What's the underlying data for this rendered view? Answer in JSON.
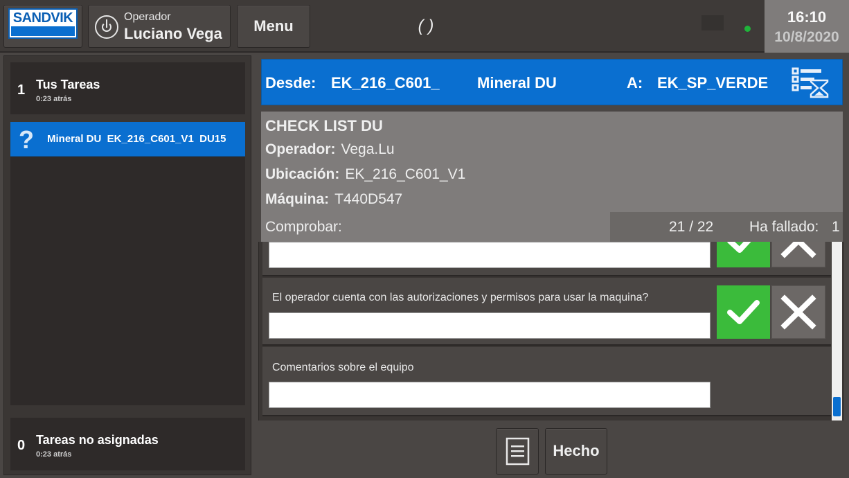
{
  "topbar": {
    "brand": "SANDVIK",
    "operator_label": "Operador",
    "operator_name": "Luciano Vega",
    "menu_label": "Menu",
    "center_text": "( )",
    "time": "16:10",
    "date": "10/8/2020",
    "status_color": "#1fb33a"
  },
  "sidebar": {
    "my_tasks": {
      "count": "1",
      "title": "Tus Tareas",
      "ago": "0:23 atrás"
    },
    "tasks": [
      {
        "icon": "question-icon",
        "label": "Mineral DU  EK_216_C601_V1  DU15"
      }
    ],
    "unassigned": {
      "count": "0",
      "title": "Tareas no asignadas",
      "ago": "0:23 atrás"
    }
  },
  "route": {
    "from_label": "Desde:",
    "from_value": "EK_216_C601_",
    "material": "Mineral DU",
    "to_label": "A:",
    "to_value": "EK_SP_VERDE",
    "icon": "task-list-hourglass-icon"
  },
  "checklist": {
    "title": "CHECK LIST DU",
    "operator_label": "Operador:",
    "operator_value": "Vega.Lu",
    "location_label": "Ubicación:",
    "location_value": "EK_216_C601_V1",
    "machine_label": "Máquina:",
    "machine_value": "T440D547",
    "check_label": "Comprobar:",
    "progress": "21  /  22",
    "failed_label": "Ha fallado:",
    "failed_value": "1",
    "items": [
      {
        "question": "",
        "answer": ""
      },
      {
        "question": "El operador cuenta con las autorizaciones y permisos para usar la maquina?",
        "answer": ""
      },
      {
        "question": "Comentarios sobre el equipo",
        "answer": ""
      }
    ]
  },
  "actions": {
    "done_label": "Hecho"
  },
  "colors": {
    "accent": "#0a6fd0",
    "ok": "#3bbb3b",
    "header": "#7f7c7b",
    "background": "#4a4644"
  }
}
